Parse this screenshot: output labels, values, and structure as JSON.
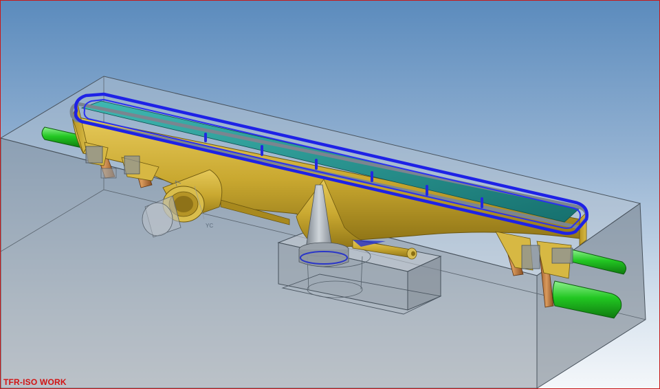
{
  "view": {
    "label": "TFR-ISO WORK"
  },
  "axis_labels": {
    "yc": "YC"
  },
  "colors": {
    "border": "#c81818",
    "view_label": "#d21414",
    "part_body": "#c9a830",
    "cavity_rim": "#1e22e6",
    "cavity_inner": "#1f8a88",
    "slider": "#22c722",
    "mold_block": "#9aa3ad"
  },
  "icons": {
    "view_triad": "wcs-axis-icon"
  }
}
